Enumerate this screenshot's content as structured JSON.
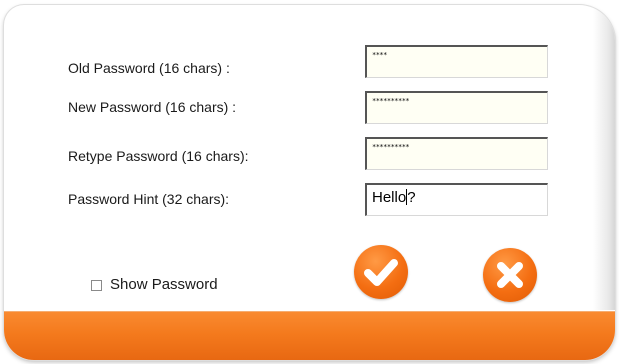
{
  "form": {
    "old_password": {
      "label": "Old Password (16 chars) :",
      "value": "****"
    },
    "new_password": {
      "label": "New Password (16 chars) :",
      "value": "**********"
    },
    "retype_password": {
      "label": "Retype Password (16 chars):",
      "value": "**********"
    },
    "password_hint": {
      "label": "Password Hint (32 chars):",
      "value": "Hello",
      "value_after_caret": "?"
    },
    "show_password": {
      "label": "Show Password",
      "checked": false
    }
  },
  "buttons": {
    "confirm_icon": "checkmark-icon",
    "cancel_icon": "x-icon"
  },
  "colors": {
    "accent": "#f47a1d",
    "field_background": "#fffff4"
  }
}
